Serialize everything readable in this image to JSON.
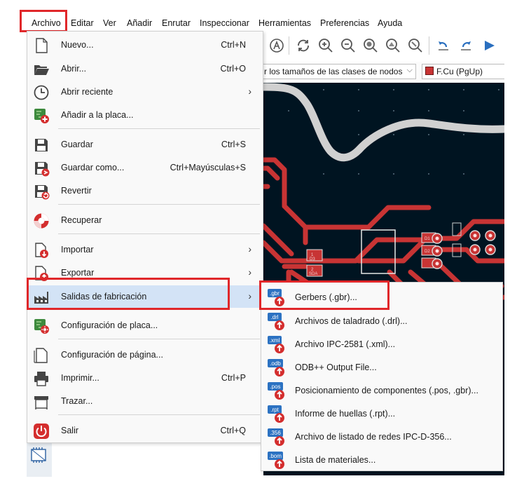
{
  "menubar": {
    "items": [
      {
        "label": "Archivo"
      },
      {
        "label": "Editar"
      },
      {
        "label": "Ver"
      },
      {
        "label": "Añadir"
      },
      {
        "label": "Enrutar"
      },
      {
        "label": "Inspeccionar"
      },
      {
        "label": "Herramientas"
      },
      {
        "label": "Preferencias"
      },
      {
        "label": "Ayuda"
      }
    ]
  },
  "toolbar": {
    "netclass_select": "r los tamaños de las clases de nodos",
    "layer_select": "F.Cu (PgUp)",
    "layer_color": "#c83434"
  },
  "file_menu": {
    "items": [
      {
        "label": "Nuevo...",
        "shortcut": "Ctrl+N",
        "icon": "new-file-icon"
      },
      {
        "label": "Abrir...",
        "shortcut": "Ctrl+O",
        "icon": "folder-open-icon"
      },
      {
        "label": "Abrir reciente",
        "shortcut": "",
        "icon": "clock-icon"
      },
      {
        "label": "Añadir a la placa...",
        "shortcut": "",
        "icon": "add-board-icon"
      },
      {
        "label": "Guardar",
        "shortcut": "Ctrl+S",
        "icon": "save-icon"
      },
      {
        "label": "Guardar como...",
        "shortcut": "Ctrl+Mayúsculas+S",
        "icon": "save-as-icon"
      },
      {
        "label": "Revertir",
        "shortcut": "",
        "icon": "revert-icon"
      },
      {
        "label": "Recuperar",
        "shortcut": "",
        "icon": "recover-icon"
      },
      {
        "label": "Importar",
        "shortcut": "",
        "icon": "import-icon"
      },
      {
        "label": "Exportar",
        "shortcut": "",
        "icon": "export-icon"
      },
      {
        "label": "Salidas de fabricación",
        "shortcut": "",
        "icon": "factory-icon"
      },
      {
        "label": "Configuración de placa...",
        "shortcut": "",
        "icon": "board-setup-icon"
      },
      {
        "label": "Configuración de página...",
        "shortcut": "",
        "icon": "page-setup-icon"
      },
      {
        "label": "Imprimir...",
        "shortcut": "Ctrl+P",
        "icon": "printer-icon"
      },
      {
        "label": "Trazar...",
        "shortcut": "",
        "icon": "plotter-icon"
      },
      {
        "label": "Salir",
        "shortcut": "Ctrl+Q",
        "icon": "power-icon"
      }
    ]
  },
  "fab_submenu": {
    "items": [
      {
        "label": "Gerbers (.gbr)...",
        "badge": ".gbr"
      },
      {
        "label": "Archivos de taladrado (.drl)...",
        "badge": ".drl"
      },
      {
        "label": "Archivo IPC-2581 (.xml)...",
        "badge": ".xml"
      },
      {
        "label": "ODB++ Output File...",
        "badge": ".odb"
      },
      {
        "label": "Posicionamiento de componentes (.pos, .gbr)...",
        "badge": ".pos"
      },
      {
        "label": "Informe de huellas (.rpt)...",
        "badge": ".rpt"
      },
      {
        "label": "Archivo de listado de redes IPC-D-356...",
        "badge": ".356"
      },
      {
        "label": "Lista de materiales...",
        "badge": ".bom"
      }
    ]
  },
  "canvas": {
    "labels": [
      "D1",
      "D2",
      "D3",
      "SDA"
    ],
    "pad_numbers": [
      "1",
      "2"
    ]
  },
  "colors": {
    "highlight": "#e0272a",
    "board_bg": "#001421",
    "track": "#c83434",
    "edge": "#d0d0d0"
  }
}
